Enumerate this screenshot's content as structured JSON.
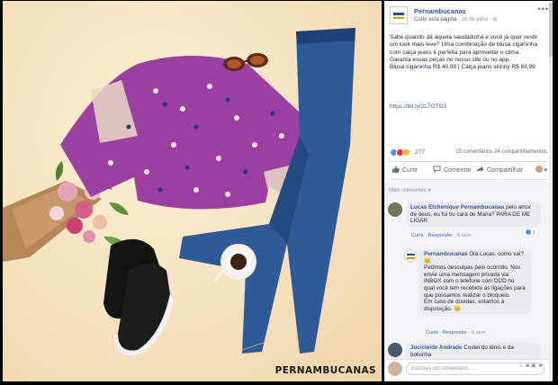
{
  "photo": {
    "brand_watermark": "PERNAMBUCANAS"
  },
  "post": {
    "page_name": "Pernambucanas",
    "meta_link": "Curtir esta página",
    "meta_date": " · 16 de julho · ",
    "text": "Sabe quando dá aquela saudadinha e você já quer vestir um look mais leve? Uma combinação de blusa ciganinha com calça jeans é perfeita para aproveitar o clima.\nGaranta essas peças no nosso site ou no app.\nBlusa ciganinha R$ 49,99 | Calça jeans skinny R$ 69,99",
    "link": "https://bit.ly/2L7GTG3",
    "reactions_count": "277",
    "comments_count": "15 comentários",
    "shares_count": "24 compartilhamentos",
    "actions": {
      "like": "Curtir",
      "comment": "Comentar",
      "share": "Compartilhar"
    }
  },
  "comments": {
    "sort_label": "Mais relevantes ▾",
    "items": [
      {
        "author": "Lucas Etchenique",
        "mention": "Pernambucanas",
        "text": " pelo amor de deus, eu fui tiu cara de Maria? PARA DE ME LIGAR",
        "actions": [
          "Curtir",
          "Responder"
        ],
        "time": "6 sem",
        "likes": "1"
      },
      {
        "author": "Pernambucanas",
        "text": " Olá Lucas, como vai? 😊\nPedimos desculpas pelo ocorrido. Nos envie uma mensagem privada via INBOX com o telefone com DDD no qual você tem recebido as ligações para que possamos realizar o bloqueio.\nEm caso de dúvidas, estamos à disposição. 😊",
        "actions": [
          "Curtir",
          "Responder"
        ],
        "time": "5 sem"
      },
      {
        "author": "Jucicleide Andrade",
        "text": " Costei do tênis e da bolsinha"
      }
    ],
    "compose_placeholder": "Escreva um comentário..."
  },
  "colors": {
    "facebook_blue": "#365899",
    "link_blue": "#4267b2",
    "text_dark": "#1d2129",
    "text_muted": "#90949c"
  }
}
